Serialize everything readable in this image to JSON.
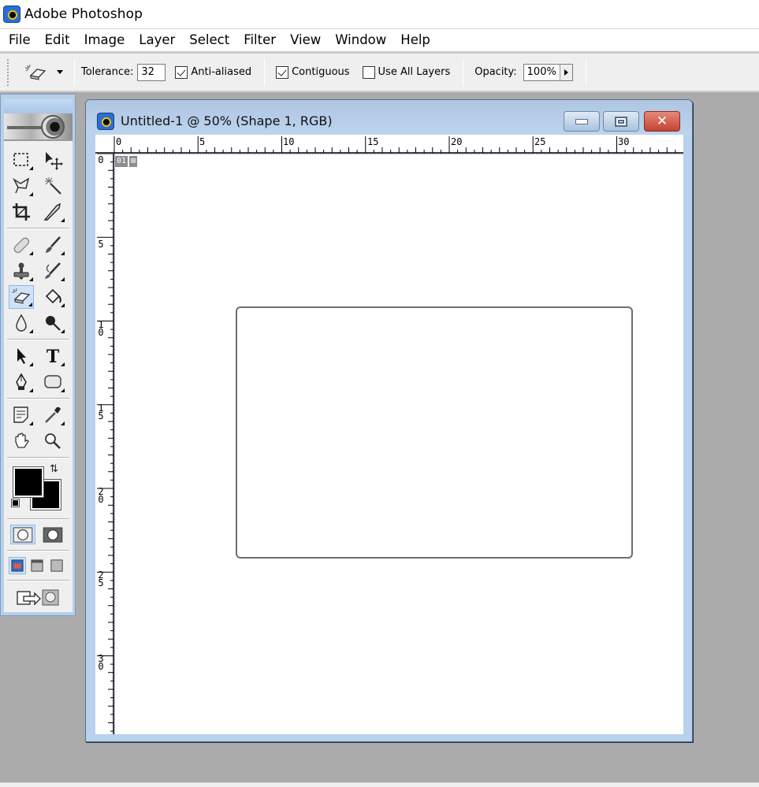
{
  "app": {
    "title": "Adobe Photoshop",
    "icon": "photoshop-eye-icon"
  },
  "menu": [
    "File",
    "Edit",
    "Image",
    "Layer",
    "Select",
    "Filter",
    "View",
    "Window",
    "Help"
  ],
  "options_bar": {
    "tool_icon": "background-eraser-icon",
    "tolerance_label": "Tolerance:",
    "tolerance_value": "32",
    "anti_aliased": {
      "label": "Anti-aliased",
      "checked": true
    },
    "contiguous": {
      "label": "Contiguous",
      "checked": true
    },
    "use_all_layers": {
      "label": "Use All Layers",
      "checked": false
    },
    "opacity_label": "Opacity:",
    "opacity_value": "100%"
  },
  "toolbox": {
    "tools": [
      {
        "name": "rectangular-marquee",
        "icon": "marquee-icon"
      },
      {
        "name": "move",
        "icon": "move-icon"
      },
      {
        "name": "lasso",
        "icon": "lasso-icon"
      },
      {
        "name": "magic-wand",
        "icon": "magic-wand-icon"
      },
      {
        "name": "crop",
        "icon": "crop-icon"
      },
      {
        "name": "slice",
        "icon": "slice-icon"
      },
      {
        "name": "healing-brush",
        "icon": "bandage-icon"
      },
      {
        "name": "brush",
        "icon": "brush-icon"
      },
      {
        "name": "clone-stamp",
        "icon": "stamp-icon"
      },
      {
        "name": "history-brush",
        "icon": "history-brush-icon"
      },
      {
        "name": "eraser",
        "icon": "eraser-icon",
        "active": true
      },
      {
        "name": "paint-bucket",
        "icon": "paint-bucket-icon"
      },
      {
        "name": "blur",
        "icon": "drop-icon"
      },
      {
        "name": "dodge",
        "icon": "dodge-icon"
      },
      {
        "name": "path-selection",
        "icon": "arrow-icon"
      },
      {
        "name": "type",
        "icon": "type-icon",
        "glyph": "T"
      },
      {
        "name": "pen",
        "icon": "pen-icon"
      },
      {
        "name": "rounded-rectangle",
        "icon": "rounded-rectangle-icon"
      },
      {
        "name": "notes",
        "icon": "notes-icon"
      },
      {
        "name": "eyedropper",
        "icon": "eyedropper-icon"
      },
      {
        "name": "hand",
        "icon": "hand-icon"
      },
      {
        "name": "zoom",
        "icon": "magnifier-icon"
      }
    ],
    "foreground_color": "#000000",
    "background_color": "#000000"
  },
  "document": {
    "title": "Untitled-1 @ 50% (Shape 1, RGB)",
    "zoom": "50%",
    "layer_name": "Shape 1",
    "color_mode": "RGB",
    "layer_badge": "01",
    "ruler_h_labels": [
      "0",
      "5",
      "10",
      "15",
      "20",
      "25",
      "30"
    ],
    "ruler_v_labels": [
      "0",
      "5",
      "10",
      "15",
      "20",
      "25",
      "30"
    ]
  },
  "colors": {
    "workspace": "#ababab",
    "window_frame": "#b8d1ec",
    "close_button": "#c44430",
    "active_tool": "#cfe3f8"
  }
}
